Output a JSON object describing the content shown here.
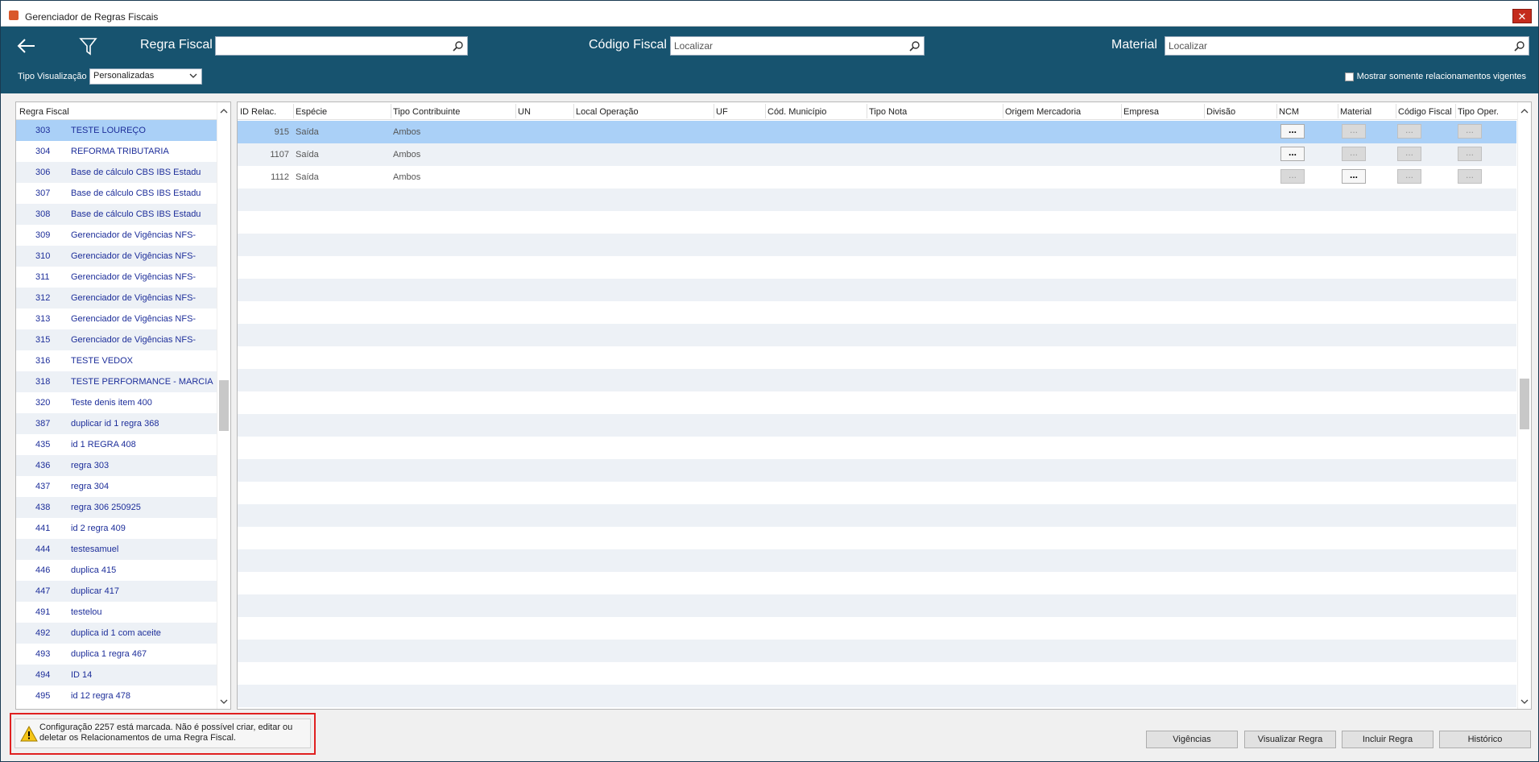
{
  "window": {
    "title": "Gerenciador de Regras Fiscais",
    "close_glyph": "✕"
  },
  "toolbar": {
    "regra_label": "Regra Fiscal",
    "regra_value": "",
    "codigo_label": "Código Fiscal",
    "codigo_placeholder": "Localizar",
    "material_label": "Material",
    "material_placeholder": "Localizar",
    "tipo_label": "Tipo Visualização",
    "tipo_value": "Personalizadas",
    "vigentes_label": "Mostrar somente relacionamentos vigentes"
  },
  "left_panel": {
    "header": "Regra Fiscal",
    "rows": [
      {
        "id": "303",
        "name": "TESTE LOUREÇO"
      },
      {
        "id": "304",
        "name": "REFORMA TRIBUTARIA"
      },
      {
        "id": "306",
        "name": "Base de cálculo CBS IBS Estadu"
      },
      {
        "id": "307",
        "name": "Base de cálculo CBS IBS Estadu"
      },
      {
        "id": "308",
        "name": "Base de cálculo CBS IBS Estadu"
      },
      {
        "id": "309",
        "name": "Gerenciador de Vigências  NFS-"
      },
      {
        "id": "310",
        "name": "Gerenciador de Vigências  NFS-"
      },
      {
        "id": "311",
        "name": "Gerenciador de Vigências  NFS-"
      },
      {
        "id": "312",
        "name": "Gerenciador de Vigências  NFS-"
      },
      {
        "id": "313",
        "name": "Gerenciador de Vigências  NFS-"
      },
      {
        "id": "315",
        "name": "Gerenciador de Vigências  NFS-"
      },
      {
        "id": "316",
        "name": "TESTE VEDOX"
      },
      {
        "id": "318",
        "name": "TESTE PERFORMANCE - MARCIA"
      },
      {
        "id": "320",
        "name": "Teste denis item 400"
      },
      {
        "id": "387",
        "name": "duplicar id 1 regra 368"
      },
      {
        "id": "435",
        "name": "id 1 REGRA 408"
      },
      {
        "id": "436",
        "name": "regra 303"
      },
      {
        "id": "437",
        "name": "regra 304"
      },
      {
        "id": "438",
        "name": "regra 306 250925"
      },
      {
        "id": "441",
        "name": "id 2 regra 409"
      },
      {
        "id": "444",
        "name": "testesamuel"
      },
      {
        "id": "446",
        "name": "duplica 415"
      },
      {
        "id": "447",
        "name": "duplicar 417"
      },
      {
        "id": "491",
        "name": "testelou"
      },
      {
        "id": "492",
        "name": "duplica id 1 com aceite"
      },
      {
        "id": "493",
        "name": "duplica 1 regra 467"
      },
      {
        "id": "494",
        "name": "ID 14"
      },
      {
        "id": "495",
        "name": "id 12 regra 478"
      }
    ]
  },
  "grid": {
    "columns": [
      "ID Relac.",
      "Espécie",
      "Tipo Contribuinte",
      "UN",
      "Local Operação",
      "UF",
      "Cód. Município",
      "Tipo Nota",
      "Origem Mercadoria",
      "Empresa",
      "Divisão",
      "NCM",
      "Material",
      "Código Fiscal",
      "Tipo Oper."
    ],
    "rows": [
      {
        "id": "915",
        "especie": "Saída",
        "tipo_contribuinte": "Ambos",
        "active": [
          "NCM"
        ]
      },
      {
        "id": "1107",
        "especie": "Saída",
        "tipo_contribuinte": "Ambos",
        "active": [
          "NCM"
        ]
      },
      {
        "id": "1112",
        "especie": "Saída",
        "tipo_contribuinte": "Ambos",
        "active": [
          "Material"
        ]
      }
    ],
    "dots_on": "...",
    "dots_off": "..."
  },
  "footer": {
    "warning": "Configuração 2257 está marcada. Não é possível criar, editar ou deletar os Relacionamentos de uma Regra Fiscal.",
    "buttons": [
      "Vigências",
      "Visualizar Regra",
      "Incluir Regra",
      "Histórico"
    ]
  }
}
